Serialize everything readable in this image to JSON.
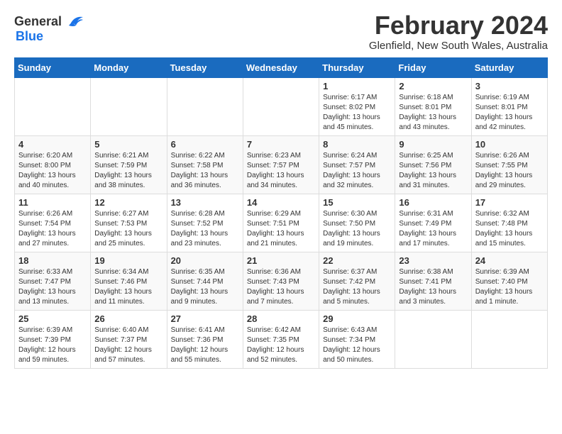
{
  "header": {
    "logo_general": "General",
    "logo_blue": "Blue",
    "title": "February 2024",
    "subtitle": "Glenfield, New South Wales, Australia"
  },
  "calendar": {
    "days_of_week": [
      "Sunday",
      "Monday",
      "Tuesday",
      "Wednesday",
      "Thursday",
      "Friday",
      "Saturday"
    ],
    "weeks": [
      [
        {
          "day": "",
          "info": ""
        },
        {
          "day": "",
          "info": ""
        },
        {
          "day": "",
          "info": ""
        },
        {
          "day": "",
          "info": ""
        },
        {
          "day": "1",
          "info": "Sunrise: 6:17 AM\nSunset: 8:02 PM\nDaylight: 13 hours\nand 45 minutes."
        },
        {
          "day": "2",
          "info": "Sunrise: 6:18 AM\nSunset: 8:01 PM\nDaylight: 13 hours\nand 43 minutes."
        },
        {
          "day": "3",
          "info": "Sunrise: 6:19 AM\nSunset: 8:01 PM\nDaylight: 13 hours\nand 42 minutes."
        }
      ],
      [
        {
          "day": "4",
          "info": "Sunrise: 6:20 AM\nSunset: 8:00 PM\nDaylight: 13 hours\nand 40 minutes."
        },
        {
          "day": "5",
          "info": "Sunrise: 6:21 AM\nSunset: 7:59 PM\nDaylight: 13 hours\nand 38 minutes."
        },
        {
          "day": "6",
          "info": "Sunrise: 6:22 AM\nSunset: 7:58 PM\nDaylight: 13 hours\nand 36 minutes."
        },
        {
          "day": "7",
          "info": "Sunrise: 6:23 AM\nSunset: 7:57 PM\nDaylight: 13 hours\nand 34 minutes."
        },
        {
          "day": "8",
          "info": "Sunrise: 6:24 AM\nSunset: 7:57 PM\nDaylight: 13 hours\nand 32 minutes."
        },
        {
          "day": "9",
          "info": "Sunrise: 6:25 AM\nSunset: 7:56 PM\nDaylight: 13 hours\nand 31 minutes."
        },
        {
          "day": "10",
          "info": "Sunrise: 6:26 AM\nSunset: 7:55 PM\nDaylight: 13 hours\nand 29 minutes."
        }
      ],
      [
        {
          "day": "11",
          "info": "Sunrise: 6:26 AM\nSunset: 7:54 PM\nDaylight: 13 hours\nand 27 minutes."
        },
        {
          "day": "12",
          "info": "Sunrise: 6:27 AM\nSunset: 7:53 PM\nDaylight: 13 hours\nand 25 minutes."
        },
        {
          "day": "13",
          "info": "Sunrise: 6:28 AM\nSunset: 7:52 PM\nDaylight: 13 hours\nand 23 minutes."
        },
        {
          "day": "14",
          "info": "Sunrise: 6:29 AM\nSunset: 7:51 PM\nDaylight: 13 hours\nand 21 minutes."
        },
        {
          "day": "15",
          "info": "Sunrise: 6:30 AM\nSunset: 7:50 PM\nDaylight: 13 hours\nand 19 minutes."
        },
        {
          "day": "16",
          "info": "Sunrise: 6:31 AM\nSunset: 7:49 PM\nDaylight: 13 hours\nand 17 minutes."
        },
        {
          "day": "17",
          "info": "Sunrise: 6:32 AM\nSunset: 7:48 PM\nDaylight: 13 hours\nand 15 minutes."
        }
      ],
      [
        {
          "day": "18",
          "info": "Sunrise: 6:33 AM\nSunset: 7:47 PM\nDaylight: 13 hours\nand 13 minutes."
        },
        {
          "day": "19",
          "info": "Sunrise: 6:34 AM\nSunset: 7:46 PM\nDaylight: 13 hours\nand 11 minutes."
        },
        {
          "day": "20",
          "info": "Sunrise: 6:35 AM\nSunset: 7:44 PM\nDaylight: 13 hours\nand 9 minutes."
        },
        {
          "day": "21",
          "info": "Sunrise: 6:36 AM\nSunset: 7:43 PM\nDaylight: 13 hours\nand 7 minutes."
        },
        {
          "day": "22",
          "info": "Sunrise: 6:37 AM\nSunset: 7:42 PM\nDaylight: 13 hours\nand 5 minutes."
        },
        {
          "day": "23",
          "info": "Sunrise: 6:38 AM\nSunset: 7:41 PM\nDaylight: 13 hours\nand 3 minutes."
        },
        {
          "day": "24",
          "info": "Sunrise: 6:39 AM\nSunset: 7:40 PM\nDaylight: 13 hours\nand 1 minute."
        }
      ],
      [
        {
          "day": "25",
          "info": "Sunrise: 6:39 AM\nSunset: 7:39 PM\nDaylight: 12 hours\nand 59 minutes."
        },
        {
          "day": "26",
          "info": "Sunrise: 6:40 AM\nSunset: 7:37 PM\nDaylight: 12 hours\nand 57 minutes."
        },
        {
          "day": "27",
          "info": "Sunrise: 6:41 AM\nSunset: 7:36 PM\nDaylight: 12 hours\nand 55 minutes."
        },
        {
          "day": "28",
          "info": "Sunrise: 6:42 AM\nSunset: 7:35 PM\nDaylight: 12 hours\nand 52 minutes."
        },
        {
          "day": "29",
          "info": "Sunrise: 6:43 AM\nSunset: 7:34 PM\nDaylight: 12 hours\nand 50 minutes."
        },
        {
          "day": "",
          "info": ""
        },
        {
          "day": "",
          "info": ""
        }
      ]
    ]
  }
}
